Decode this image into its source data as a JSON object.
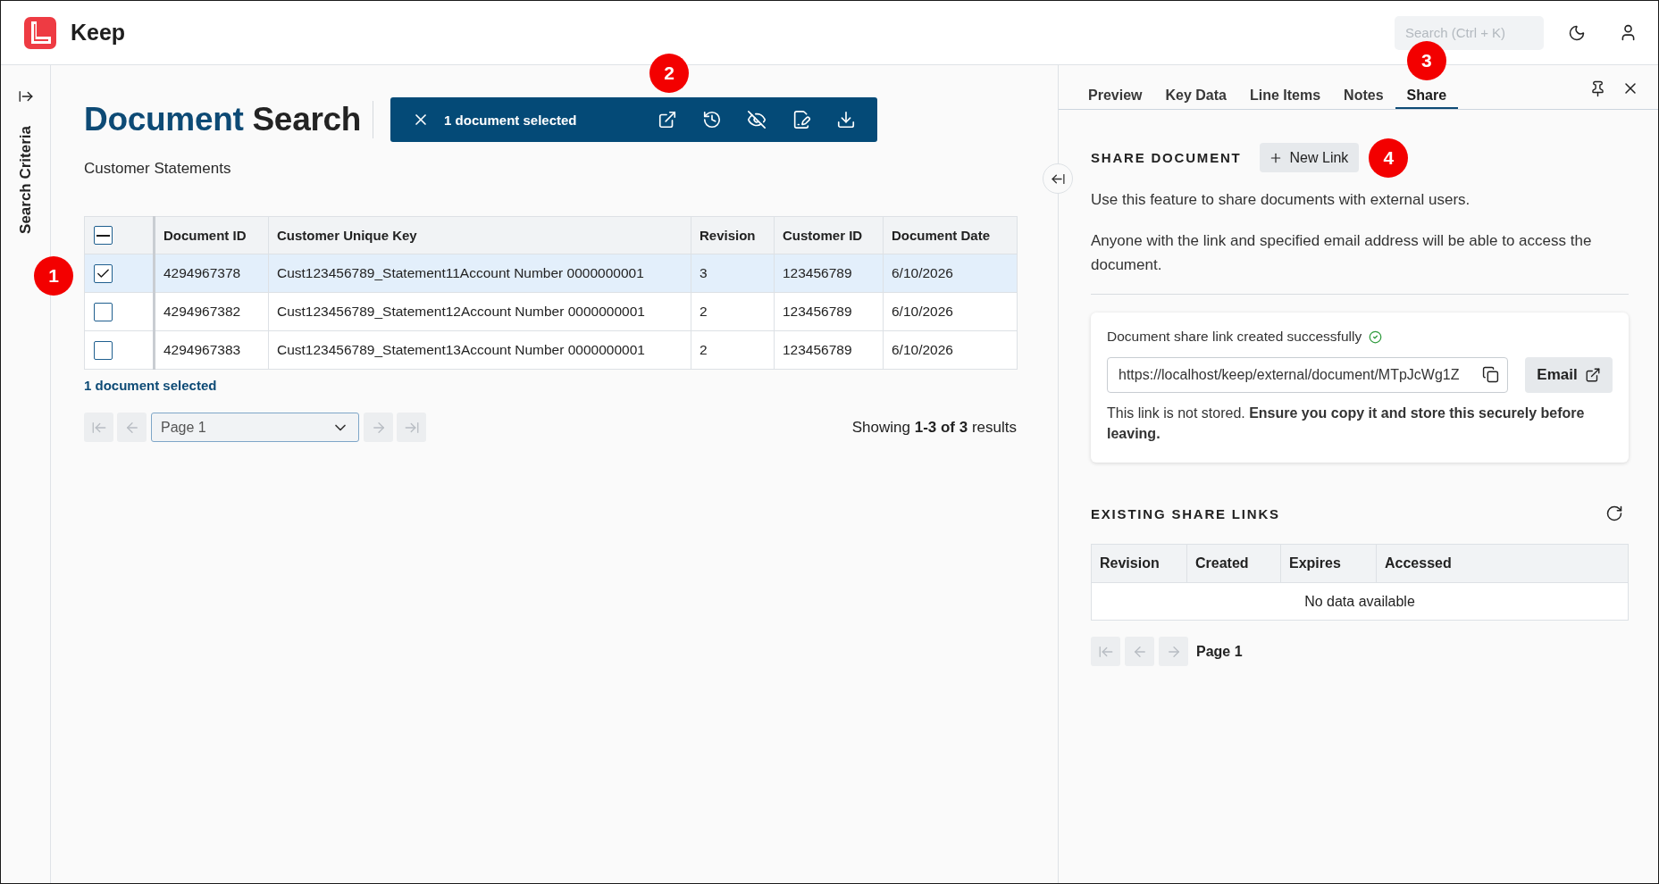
{
  "header": {
    "app_name": "Keep",
    "search": {
      "placeholder": "Search (Ctrl + K)"
    }
  },
  "sidebar": {
    "label": "Search Criteria"
  },
  "page": {
    "title": {
      "primary": "Document",
      "secondary": "Search"
    },
    "subtitle": "Customer Statements"
  },
  "selection_toolbar": {
    "label": "1 document selected",
    "callout": "2"
  },
  "table": {
    "select_all": {
      "indeterminate": true
    },
    "columns": [
      "Document ID",
      "Customer Unique Key",
      "Revision",
      "Customer ID",
      "Document Date"
    ],
    "rows": [
      {
        "selected": true,
        "callout": "1",
        "cells": [
          "4294967378",
          "Cust123456789_Statement11Account Number 0000000001",
          "3",
          "123456789",
          "6/10/2026"
        ]
      },
      {
        "selected": false,
        "cells": [
          "4294967382",
          "Cust123456789_Statement12Account Number 0000000001",
          "2",
          "123456789",
          "6/10/2026"
        ]
      },
      {
        "selected": false,
        "cells": [
          "4294967383",
          "Cust123456789_Statement13Account Number 0000000001",
          "2",
          "123456789",
          "6/10/2026"
        ]
      }
    ]
  },
  "selection_summary": "1 document selected",
  "pagination": {
    "first": {
      "disabled": true
    },
    "previous": {
      "disabled": true
    },
    "page_select": {
      "value": "Page 1"
    },
    "next": {
      "disabled": true
    },
    "last": {
      "disabled": true
    },
    "summary": "Showing **1-3 of 3** results"
  },
  "details_panel": {
    "tabs": [
      {
        "label": "Preview",
        "selected": false
      },
      {
        "label": "Key Data",
        "selected": false
      },
      {
        "label": "Line Items",
        "selected": false
      },
      {
        "label": "Notes",
        "selected": false
      },
      {
        "label": "Share",
        "selected": true,
        "callout": "3"
      }
    ],
    "share": {
      "heading": "SHARE DOCUMENT",
      "new_link_button": {
        "label": "New Link",
        "callout": "4"
      },
      "paragraphs": [
        "Use this feature to share documents with external users.",
        "Anyone with the link and specified email address will be able to access the document."
      ],
      "result": {
        "message": "Document share link created successfully",
        "link": "https://localhost/keep/external/document/MTpJcWg1Z",
        "email_button": "Email",
        "note": "This link is not stored. **Ensure you copy it and store this securely before leaving.**"
      },
      "existing": {
        "heading": "EXISTING SHARE LINKS",
        "columns": [
          "Revision",
          "Created",
          "Expires",
          "Accessed"
        ],
        "empty_message": "No data available",
        "pagination": {
          "first": {
            "disabled": true
          },
          "previous": {
            "disabled": true
          },
          "next": {
            "disabled": true
          },
          "page": "Page 1"
        }
      }
    }
  }
}
